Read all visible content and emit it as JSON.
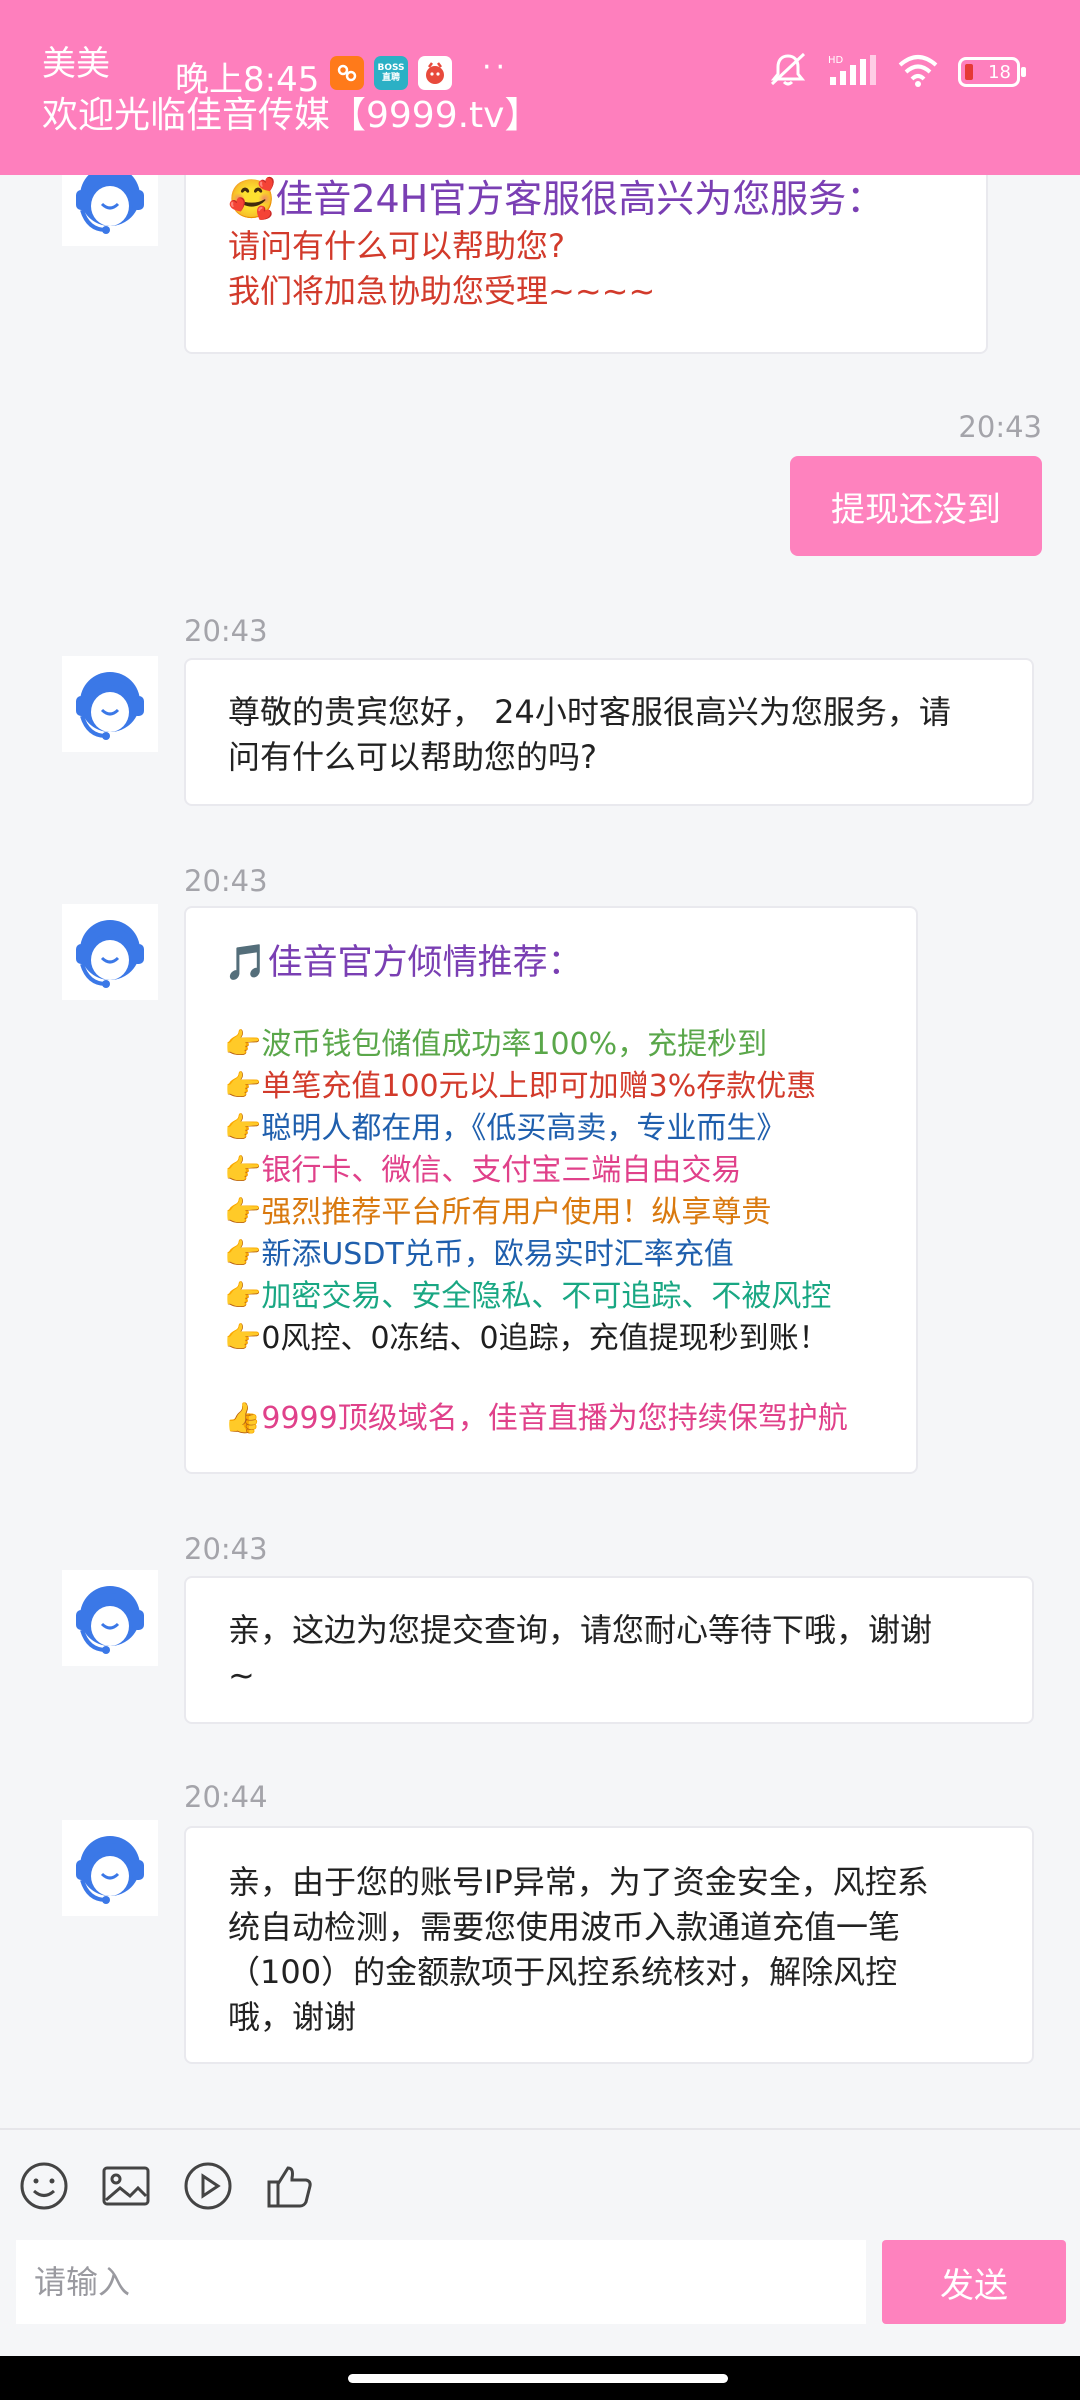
{
  "status_bar": {
    "time": "晚上8:45",
    "battery": "18",
    "dots": "··",
    "app_badge_2": "BOSS 直聘"
  },
  "header": {
    "agent_name": "美美",
    "title": "欢迎光临佳音传媒【9999.tv】"
  },
  "messages": [
    {
      "sender": "agent",
      "lines": [
        "🥰佳音24H官方客服很高兴为您服务：",
        "请问有什么可以帮助您?",
        "我们将加急协助您受理~~~~"
      ]
    },
    {
      "sender": "user",
      "time": "20:43",
      "text": "提现还没到"
    },
    {
      "sender": "agent",
      "time": "20:43",
      "lines": [
        "尊敬的贵宾您好， 24小时客服很高兴为您服务，请",
        "问有什么可以帮助您的吗?"
      ]
    },
    {
      "sender": "agent",
      "time": "20:43",
      "lines": [
        "🎵佳音官方倾情推荐：",
        "👉波币钱包储值成功率100%，充提秒到",
        "👉单笔充值100元以上即可加赠3%存款优惠",
        "👉聪明人都在用，《低买高卖，专业而生》",
        "👉银行卡、微信、支付宝三端自由交易",
        "👉强烈推荐平台所有用户使用！纵享尊贵",
        "👉新添USDT兑币，欧易实时汇率充值",
        "👉加密交易、安全隐私、不可追踪、不被风控",
        "👉0风控、0冻结、0追踪，充值提现秒到账！",
        "👍9999顶级域名，佳音直播为您持续保驾护航"
      ]
    },
    {
      "sender": "agent",
      "time": "20:43",
      "lines": [
        "亲，这边为您提交查询，请您耐心等待下哦，谢谢",
        "~"
      ]
    },
    {
      "sender": "agent",
      "time": "20:44",
      "lines": [
        "亲，由于您的账号IP异常，为了资金安全，风控系",
        "统自动检测，需要您使用波币入款通道充值一笔",
        "（100）的金额款项于风控系统核对，解除风控",
        "哦，谢谢"
      ]
    }
  ],
  "input": {
    "placeholder": "请输入",
    "send_label": "发送"
  },
  "colors": {
    "accent": "#fe7fbd",
    "send_button": "#fe82be",
    "avatar_blue": "#3b78e7"
  },
  "icons": [
    "smile-icon",
    "image-icon",
    "video-icon",
    "thumbs-up-icon"
  ]
}
